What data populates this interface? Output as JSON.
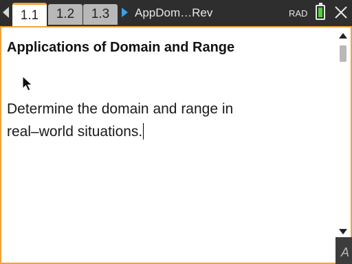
{
  "tabs": [
    {
      "label": "1.1",
      "active": true
    },
    {
      "label": "1.2",
      "active": false
    },
    {
      "label": "1.3",
      "active": false
    }
  ],
  "document": {
    "title": "AppDom…Rev"
  },
  "status": {
    "angle_mode": "RAD",
    "battery_color": "#4fd13a"
  },
  "page": {
    "heading": "Applications of Domain and Range",
    "body_line1": "Determine the domain and range in",
    "body_line2": "real–world situations."
  },
  "corner": {
    "glyph": "A"
  },
  "colors": {
    "accent": "#f2a33a",
    "nav_arrow": "#3aa0e8"
  }
}
